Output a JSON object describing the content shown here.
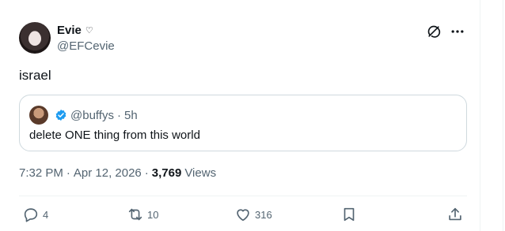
{
  "author": {
    "name": "Evie",
    "badge_glyph": "♡",
    "handle": "@EFCevie"
  },
  "tweet": {
    "text": "israel"
  },
  "quote": {
    "handle": "@buffys",
    "separator": "·",
    "time": "5h",
    "text": "delete ONE thing from this world"
  },
  "meta": {
    "time": "7:32 PM",
    "sep1": "·",
    "date": "Apr 12, 2026",
    "sep2": "·",
    "views_count": "3,769",
    "views_label": "Views"
  },
  "actions": {
    "replies": "4",
    "reposts": "10",
    "likes": "316"
  },
  "colors": {
    "text": "#0f1419",
    "muted": "#536471",
    "border": "#cfd9de",
    "verified": "#1d9bf0"
  },
  "icons": [
    "grok-icon",
    "more-icon",
    "verified-icon",
    "reply-icon",
    "repost-icon",
    "like-icon",
    "bookmark-icon",
    "share-icon"
  ]
}
